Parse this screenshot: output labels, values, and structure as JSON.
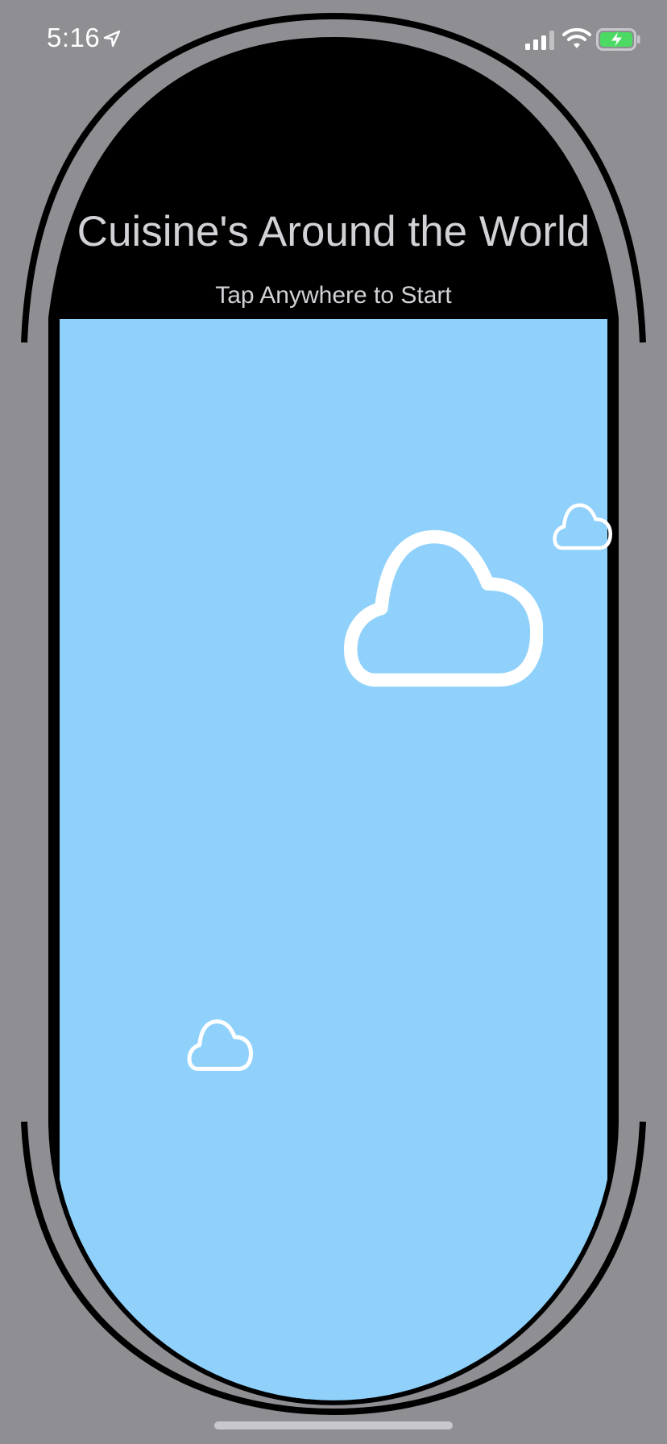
{
  "status_bar": {
    "time": "5:16",
    "icons": [
      "location-arrow-icon",
      "cellular-signal-icon",
      "wifi-icon",
      "battery-charging-icon"
    ],
    "battery_color": "#4cd964"
  },
  "main": {
    "title": "Cuisine's Around the World",
    "subtitle": "Tap Anywhere to Start"
  },
  "colors": {
    "background": "#8e8e93",
    "sky": "#8fd1fb",
    "header": "#000000",
    "text": "#d1d1d6",
    "cloud_outline": "#ffffff"
  },
  "clouds": [
    "cloud-icon-large",
    "cloud-icon-small-top-right",
    "cloud-icon-small-bottom-left"
  ]
}
